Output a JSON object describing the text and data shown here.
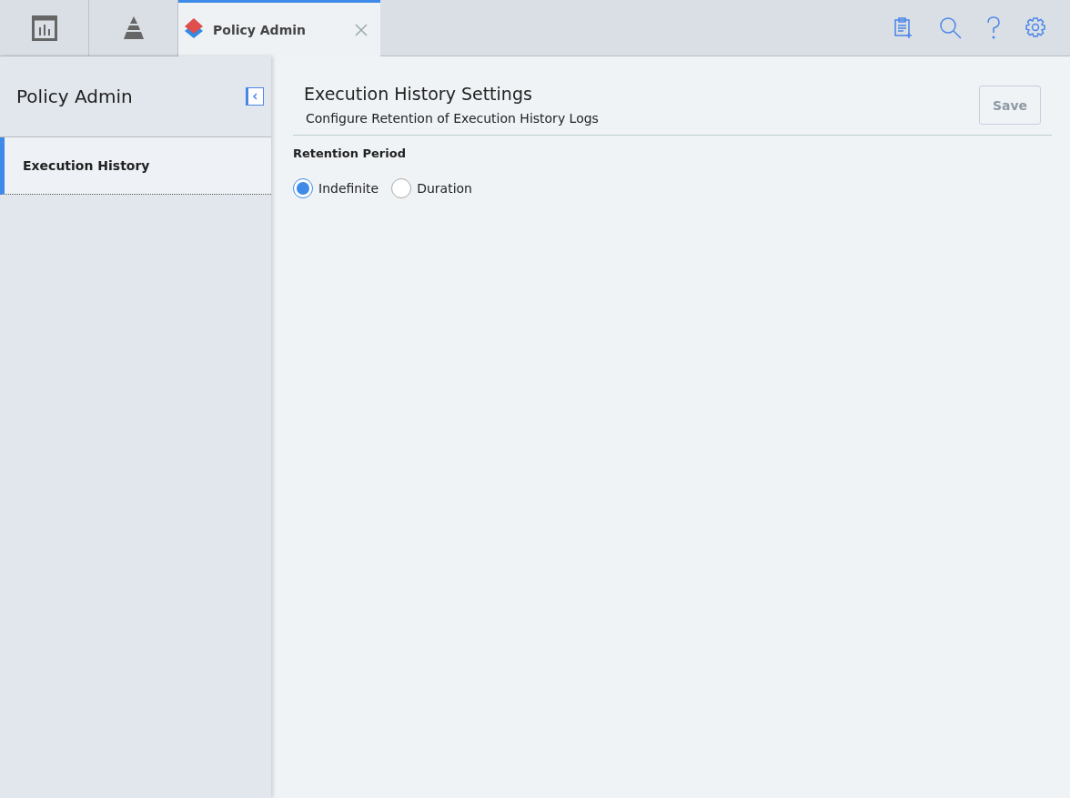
{
  "tabs": [
    {
      "kind": "icon",
      "selected": false
    },
    {
      "kind": "icon",
      "selected": false
    },
    {
      "kind": "text",
      "label": "Policy Admin",
      "selected": true
    }
  ],
  "sidebar": {
    "title": "Policy Admin",
    "items": [
      {
        "label": "Execution History",
        "selected": true
      }
    ]
  },
  "page": {
    "title": "Execution History Settings",
    "subtitle": "Configure Retention of Execution History Logs",
    "save": {
      "label": "Save",
      "disabled": true
    }
  },
  "retention": {
    "label": "Retention Period",
    "options": [
      {
        "label": "Indefinite",
        "selected": true
      },
      {
        "label": "Duration",
        "selected": false
      }
    ]
  }
}
